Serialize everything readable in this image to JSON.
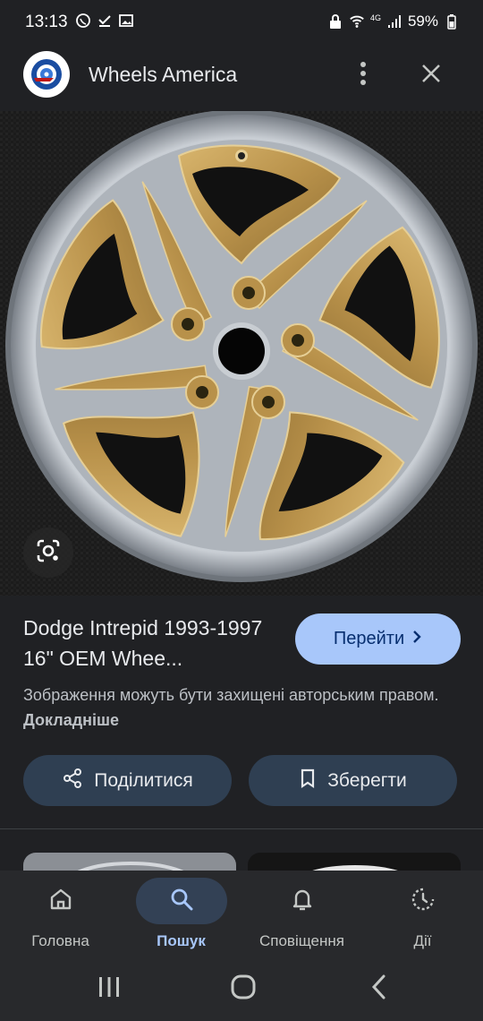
{
  "status_bar": {
    "time": "13:13",
    "network": "4G",
    "battery": "59%"
  },
  "header": {
    "site_name": "Wheels America",
    "logo": "wheels-america-logo",
    "more_icon": "more-vert-icon",
    "close_icon": "close-icon"
  },
  "image": {
    "subject": "alloy-wheel-gold-silver",
    "lens_icon": "google-lens-icon"
  },
  "result": {
    "title": "Dodge Intrepid 1993-1997 16\" OEM Whee...",
    "go_button": "Перейти",
    "copyright_text": "Зображення можуть бути захищені авторським правом.",
    "learn_more": "Докладніше"
  },
  "actions": {
    "share": "Поділитися",
    "save": "Зберегти"
  },
  "bottom_nav": {
    "items": [
      {
        "label": "Головна",
        "icon": "home-icon",
        "active": false
      },
      {
        "label": "Пошук",
        "icon": "search-icon",
        "active": true
      },
      {
        "label": "Сповіщення",
        "icon": "bell-icon",
        "active": false
      },
      {
        "label": "Дії",
        "icon": "activity-icon",
        "active": false
      }
    ]
  },
  "colors": {
    "background": "#202124",
    "accent": "#a8c7fa",
    "action_button": "#2f3f52",
    "nav_background": "#28292c"
  }
}
